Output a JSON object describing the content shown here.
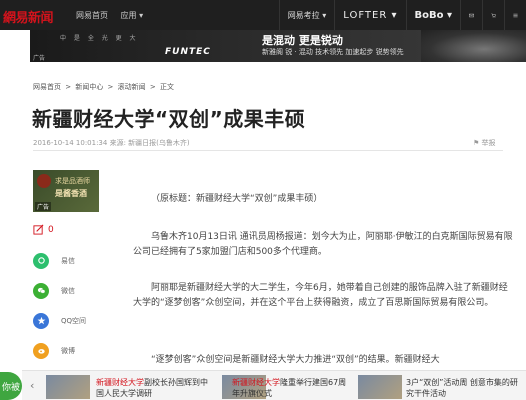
{
  "header": {
    "logo": "網易新闻",
    "nav_left": [
      "网易首页",
      "应用 ▾"
    ],
    "nav_right": [
      "网易考拉 ▾",
      "LOFTER ▾",
      "BoBo ▾"
    ],
    "icons": [
      "mail-icon",
      "cart-icon",
      "menu-icon"
    ]
  },
  "banner": {
    "tiny": "中 是 全 光 更 大",
    "brand": "FUNTEC",
    "slogan": "是混动  更是锐动",
    "sub": "新雅阁  锐 · 混动   技术领先   加速起步   锐势领先",
    "ad_label": "广告"
  },
  "breadcrumb": [
    "网易首页",
    " > ",
    "新闻中心",
    " > ",
    "滚动新闻",
    " > ",
    "正文"
  ],
  "article": {
    "title": "新疆财经大学“双创”成果丰硕",
    "meta": "2016-10-14 10:01:34   来源: 新疆日报(乌鲁木齐)",
    "fav": "⚑ 举报",
    "paragraphs": [
      "（原标题：新疆财经大学“双创”成果丰硕）",
      "乌鲁木齐10月13日讯 通讯员周杨报道：划今大为止，阿丽耶·伊敏江的白克斯国际贸易有限公司已经拥有了5家加盟门店和500多个代理商。",
      "阿丽耶是新疆财经大学的大二学生，今年6月，她带着自己创建的服饰品牌入驻了新疆财经大学的“逐梦创客”众创空间，并在这个平台上获得融资，成立了百思斯国际贸易有限公司。",
      "“逐梦创客”众创空间是新疆财经大学大力推进“双创”的结果。新疆财经大"
    ]
  },
  "sidebar": {
    "ad": {
      "line1": "求是品酒师",
      "line2": "是酱香酒",
      "tag": "广告"
    },
    "comments_count": "0",
    "share": [
      {
        "label": "易信",
        "color": "#2dbf6e",
        "icon": "yixin-icon"
      },
      {
        "label": "微信",
        "color": "#3cb034",
        "icon": "wechat-icon"
      },
      {
        "label": "QQ空间",
        "color": "#3a76d8",
        "icon": "qzone-icon"
      },
      {
        "label": "微博",
        "color": "#f0a020",
        "icon": "weibo-icon"
      }
    ]
  },
  "bottom": {
    "float_label": "你被",
    "news": [
      {
        "pre": "新疆财经大学",
        "rest": "副校长孙国辉到中国人民大学调研"
      },
      {
        "pre": "新疆财经大学",
        "rest": "隆重举行建国67周年升旗仪式"
      },
      {
        "pre": "",
        "rest": "3户“双创”活动周 创意市集的研究干件活动"
      }
    ]
  }
}
